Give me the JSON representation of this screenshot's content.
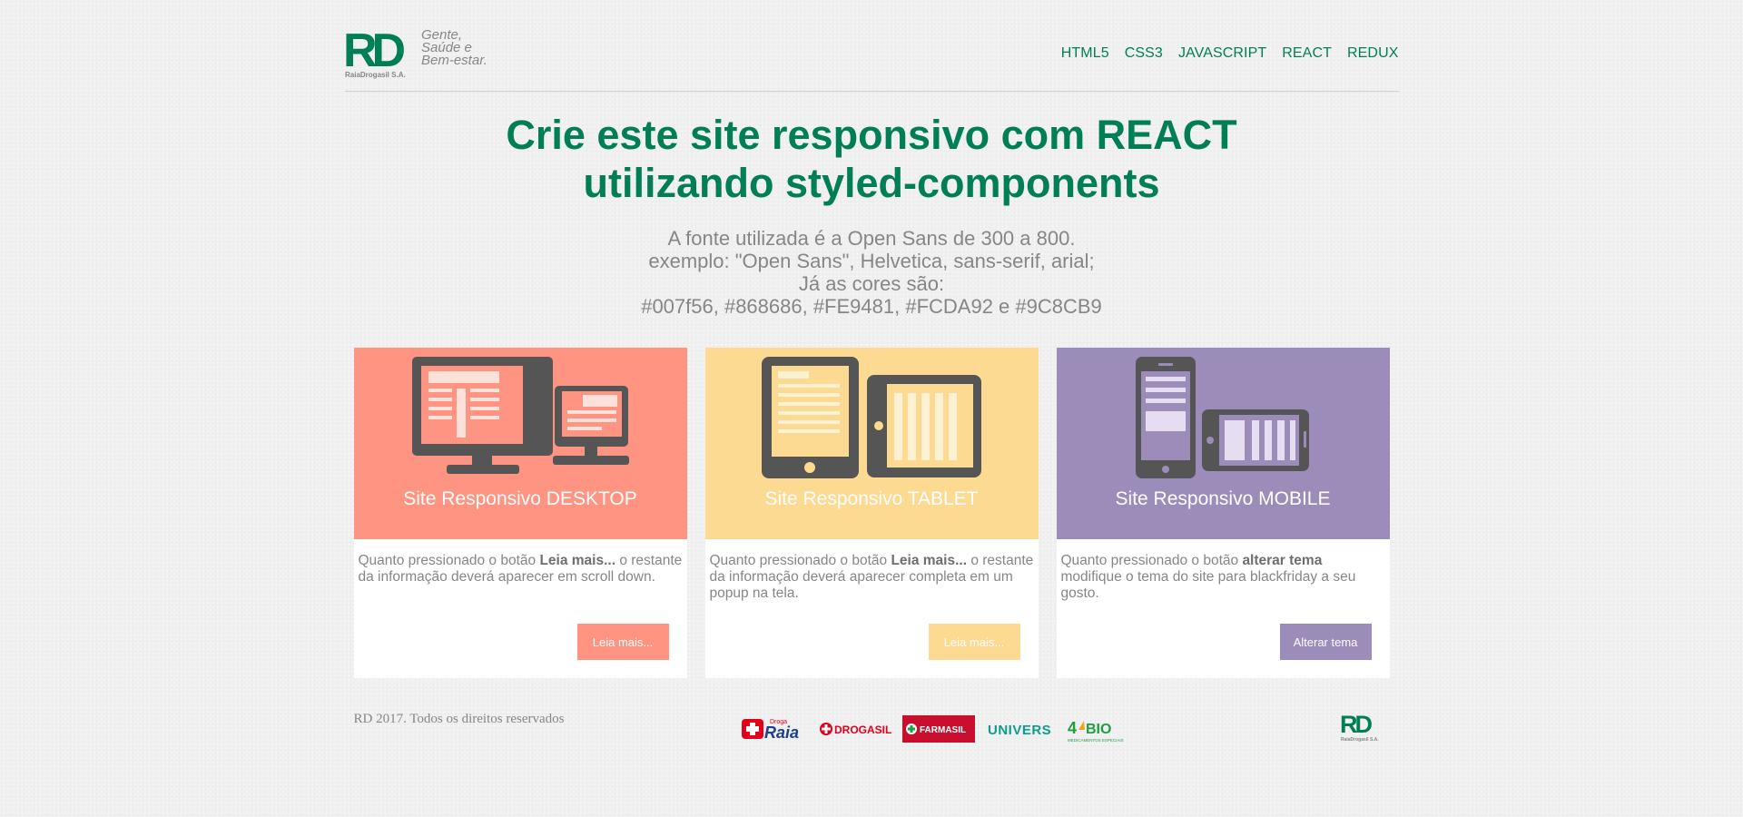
{
  "header": {
    "logo": {
      "mark": "RD",
      "tagline": [
        "Gente,",
        "Saúde e",
        "Bem-estar."
      ],
      "company": "RaiaDrogasil S.A."
    },
    "nav": [
      "HTML5",
      "CSS3",
      "JAVASCRIPT",
      "REACT",
      "REDUX"
    ]
  },
  "hero": {
    "line1": {
      "a": "Crie este site ",
      "b": "responsivo",
      "c": " com ",
      "d": "REACT"
    },
    "line2": {
      "a": "utilizando ",
      "b": "styled-components"
    },
    "info": [
      "A fonte utilizada é a Open Sans de 300 a 800.",
      "exemplo: \"Open Sans\", Helvetica, sans-serif, arial;",
      "Já as cores são:",
      "#007f56, #868686, #FE9481, #FCDA92 e #9C8CB9"
    ]
  },
  "cards": [
    {
      "title": "Site Responsivo DESKTOP",
      "color": "#FE9481",
      "desc_pre": "Quanto pressionado o botão ",
      "desc_bold": "Leia mais...",
      "desc_post": " o restante da informação deverá aparecer em scroll down.",
      "button": "Leia mais...",
      "icon": "desktop-icon"
    },
    {
      "title": "Site Responsivo TABLET",
      "color": "#FCDA92",
      "desc_pre": "Quanto pressionado o botão ",
      "desc_bold": "Leia mais...",
      "desc_post": " o restante da informação deverá aparecer completa em um popup na tela.",
      "button": "Leia mais...",
      "icon": "tablet-icon"
    },
    {
      "title": "Site Responsivo MOBILE",
      "color": "#9C8CB9",
      "desc_pre": "Quanto pressionado o botão ",
      "desc_bold": "alterar tema",
      "desc_post": " modifique o tema do site para blackfriday a seu gosto.",
      "button": "Alterar tema",
      "icon": "mobile-icon"
    }
  ],
  "footer": {
    "copyright": "RD 2017. Todos os direitos reservados",
    "brands": {
      "raia_small": "Droga",
      "raia": "Raia",
      "drogasil": "DROGASIL",
      "farmasil": "FARMASIL",
      "univers": "UNIVERS",
      "fourbio_four": "4",
      "fourbio_bio": "BIO",
      "fourbio_sub": "MEDICAMENTOS ESPECIAIS"
    },
    "logo_mark": "RD",
    "logo_company": "RaiaDrogasil S.A."
  }
}
